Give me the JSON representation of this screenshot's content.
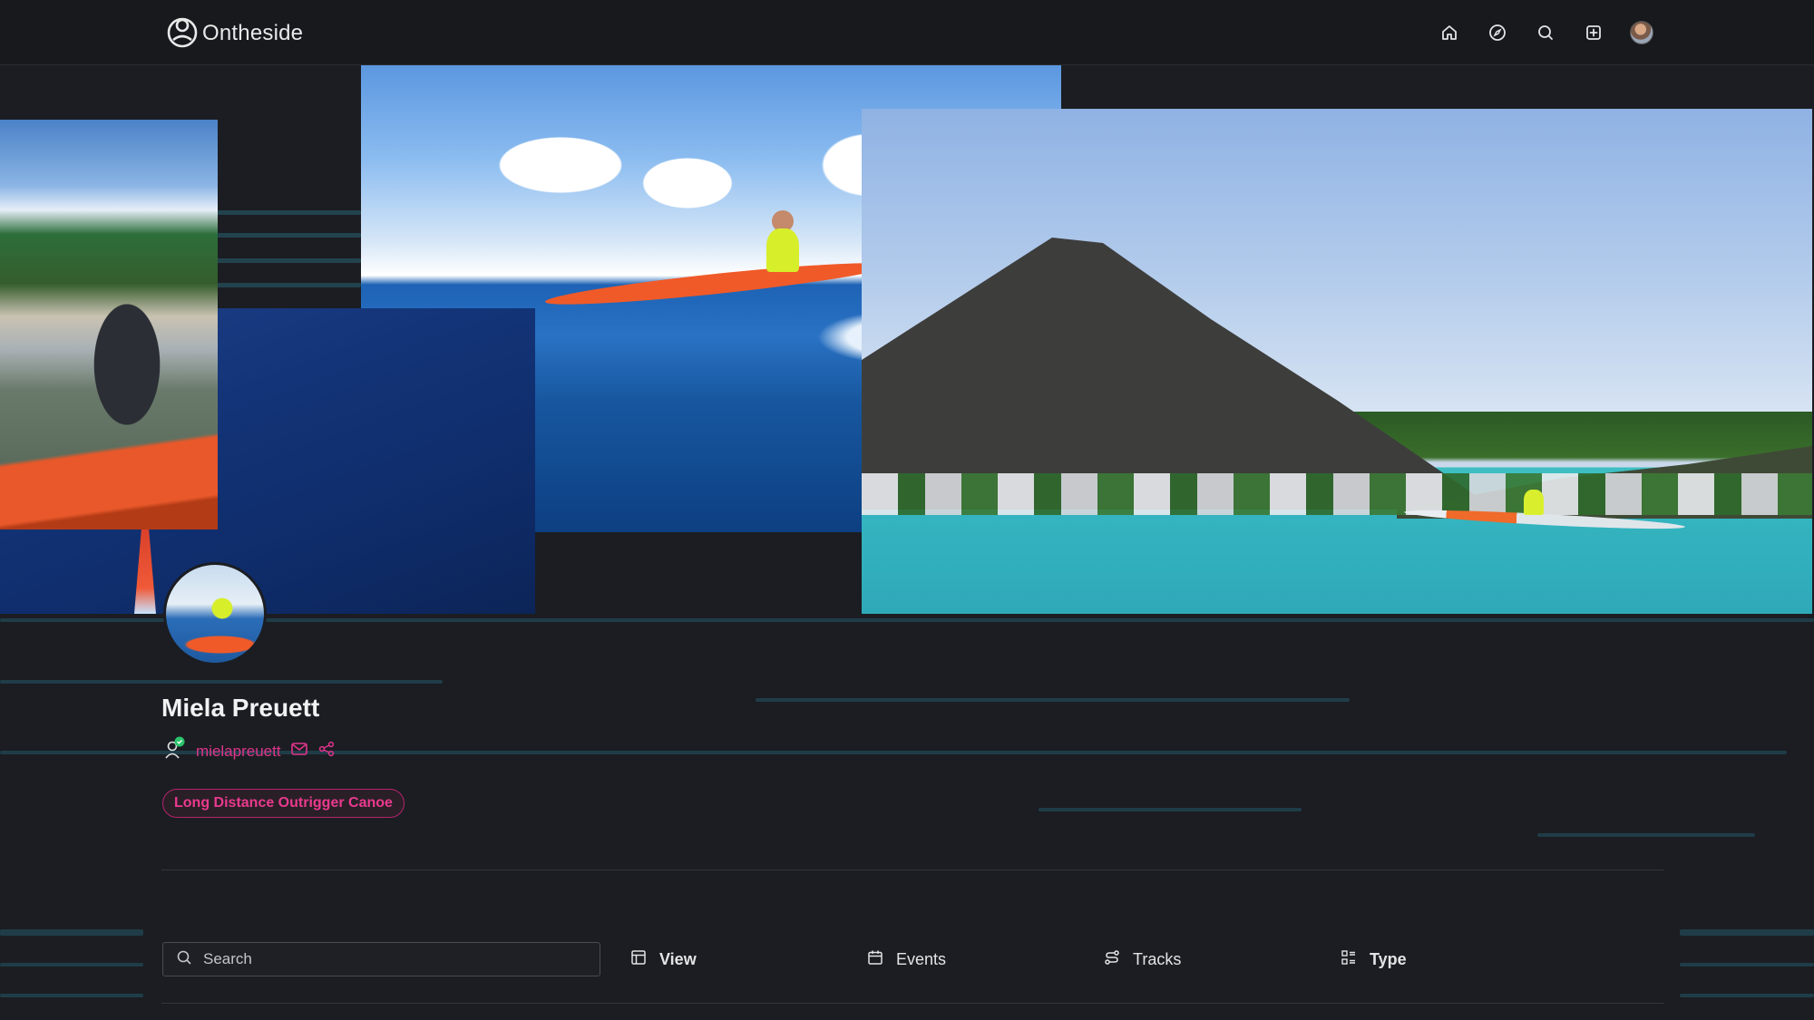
{
  "app": {
    "brand_name": "Ontheside",
    "accent_color": "#e0348b"
  },
  "nav": {
    "icons": [
      "home-icon",
      "compass-icon",
      "search-icon",
      "add-square-icon",
      "user-avatar"
    ]
  },
  "profile": {
    "name": "Miela Preuett",
    "username": "mielapreuett",
    "verified": true,
    "tag": "Long Distance Outrigger Canoe"
  },
  "toolbar": {
    "search_placeholder": "Search",
    "view_label": "View",
    "events_label": "Events",
    "tracks_label": "Tracks",
    "type_label": "Type"
  }
}
